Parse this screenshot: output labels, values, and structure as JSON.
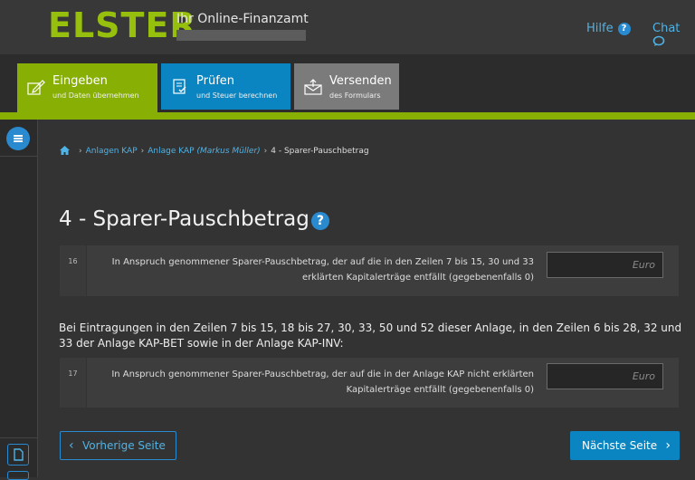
{
  "header": {
    "logo": "ELSTER",
    "subtitle": "Ihr Online-Finanzamt",
    "help": "Hilfe",
    "chat": "Chat"
  },
  "steps": [
    {
      "title": "Eingeben",
      "subtitle": "und Daten übernehmen",
      "color": "#88b004"
    },
    {
      "title": "Prüfen",
      "subtitle": "und Steuer berechnen",
      "color": "#0b85c1"
    },
    {
      "title": "Versenden",
      "subtitle": "des Formulars",
      "color": "#7b7b7b"
    }
  ],
  "breadcrumb": {
    "item1": "Anlagen KAP",
    "item2_prefix": "Anlage KAP",
    "item2_name": "(Markus Müller)",
    "current": "4 - Sparer-Pauschbetrag"
  },
  "page_title": "4 - Sparer-Pauschbetrag",
  "title_help": "?",
  "rows": [
    {
      "number": "16",
      "label": "In Anspruch genommener Sparer-Pauschbetrag, der auf die in den Zeilen 7 bis 15, 30 und 33 erklärten Kapitalerträge entfällt (gegebenenfalls 0)",
      "placeholder": "Euro"
    },
    {
      "number": "17",
      "label": "In Anspruch genommener Sparer-Pauschbetrag, der auf die in der Anlage KAP nicht erklärten Kapitalerträge entfällt (gegebenenfalls 0)",
      "placeholder": "Euro"
    }
  ],
  "note": "Bei Eintragungen in den Zeilen 7 bis 15, 18 bis 27, 30, 33, 50 und 52 dieser Anlage, in den Zeilen 6 bis 28, 32 und 33 der Anlage KAP-BET sowie in der Anlage KAP-INV:",
  "buttons": {
    "prev": "Vorherige Seite",
    "next": "Nächste Seite"
  },
  "colors": {
    "accent_green": "#88b004",
    "accent_blue": "#0b85c1",
    "link_blue": "#4fb3e6"
  }
}
